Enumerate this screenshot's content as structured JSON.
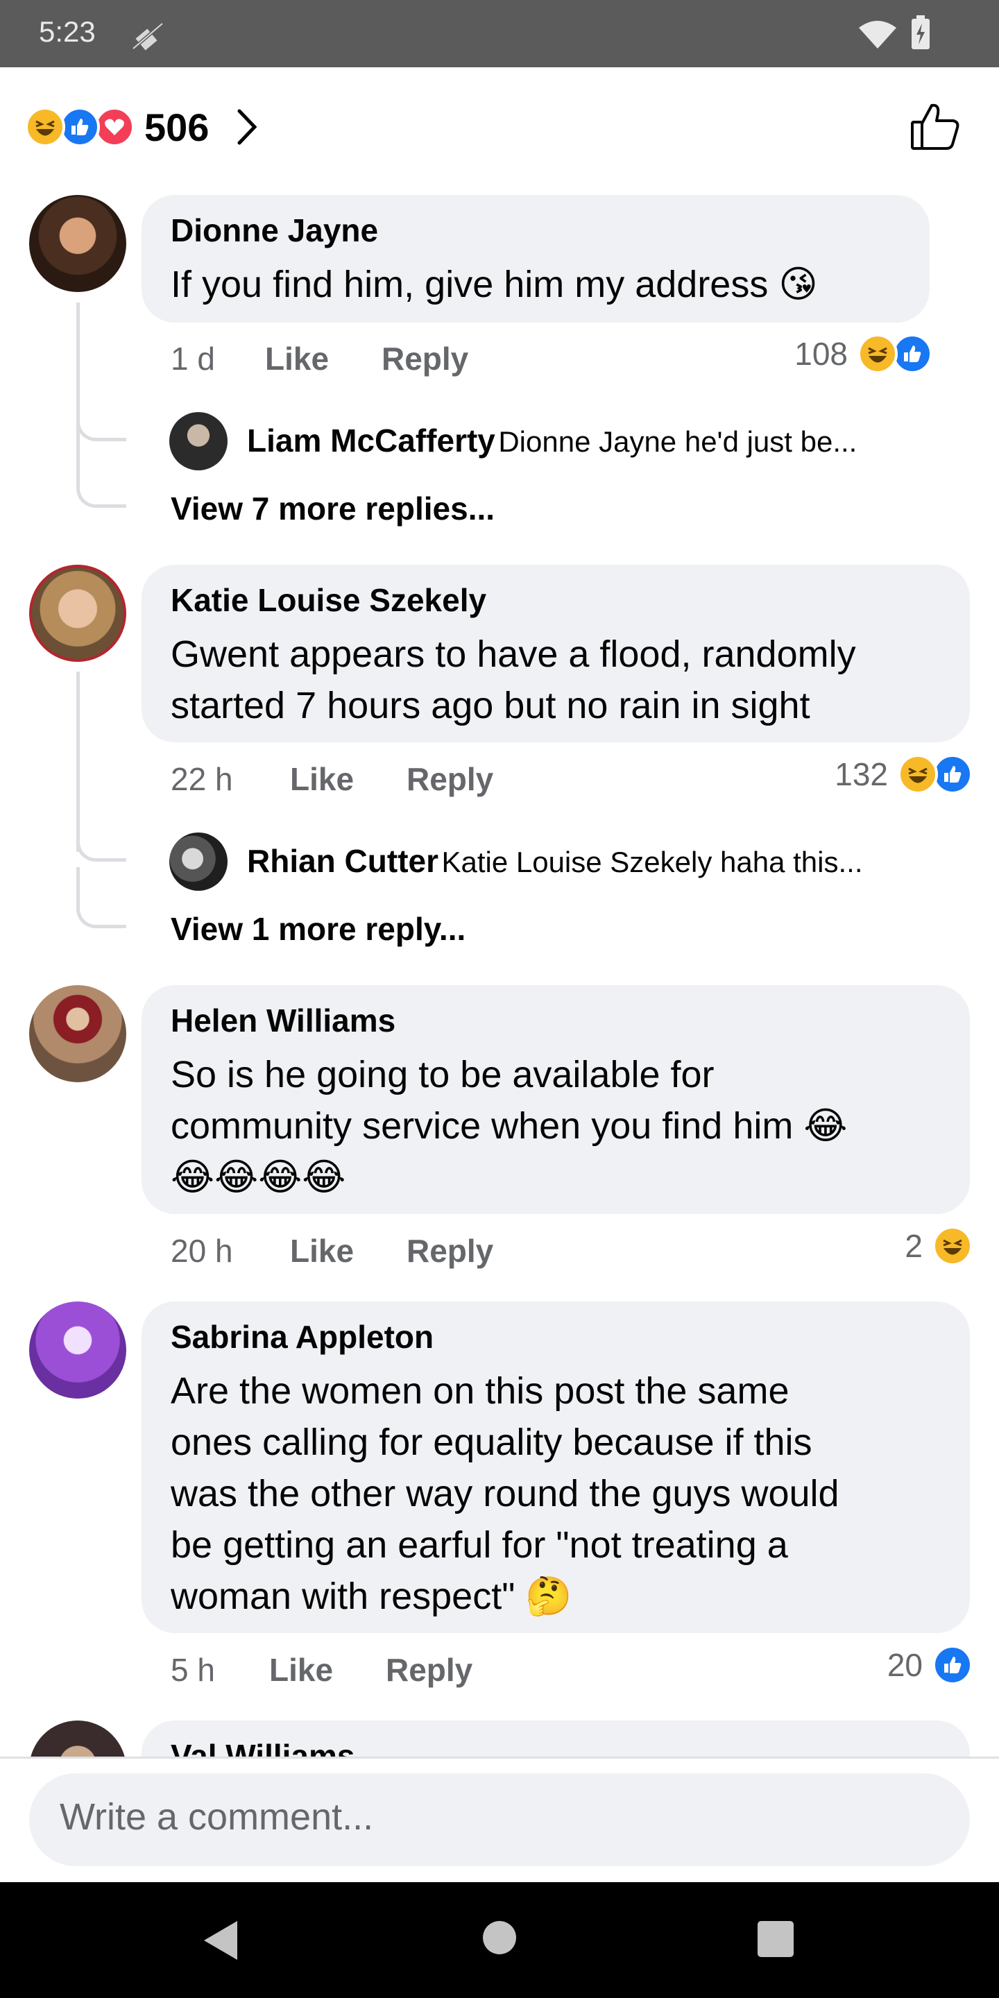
{
  "status_bar": {
    "time": "5:23"
  },
  "header": {
    "reaction_count": "506"
  },
  "comments": [
    {
      "author": "Dionne Jayne",
      "text_lines": [
        "If you find him, give him my address 😘"
      ],
      "time": "1 d",
      "like_label": "Like",
      "reply_label": "Reply",
      "reaction_count": "108",
      "reactions": [
        "haha-icon",
        "like-icon"
      ],
      "reply_preview": {
        "author": "Liam McCafferty",
        "snippet": "Dionne Jayne he'd just be..."
      },
      "view_more": "View 7 more replies..."
    },
    {
      "author": "Katie Louise Szekely",
      "text_lines": [
        "Gwent appears to have a flood, randomly",
        "started 7 hours ago but no rain in sight"
      ],
      "time": "22 h",
      "like_label": "Like",
      "reply_label": "Reply",
      "reaction_count": "132",
      "reactions": [
        "haha-icon",
        "like-icon"
      ],
      "reply_preview": {
        "author": "Rhian Cutter",
        "snippet": "Katie Louise Szekely  haha this..."
      },
      "view_more": "View 1 more reply..."
    },
    {
      "author": "Helen Williams",
      "text_lines": [
        "So is he going to be available for",
        "community service when you find him 😂",
        "😂😂😂😂"
      ],
      "time": "20 h",
      "like_label": "Like",
      "reply_label": "Reply",
      "reaction_count": "2",
      "reactions": [
        "haha-icon"
      ]
    },
    {
      "author": "Sabrina Appleton",
      "text_lines": [
        "Are the women on this post the same",
        "ones calling for equality because if this",
        "was the other way round the guys would",
        "be getting an earful for \"not treating a",
        "woman with respect\" 🤔"
      ],
      "time": "5 h",
      "like_label": "Like",
      "reply_label": "Reply",
      "reaction_count": "20",
      "reactions": [
        "like-icon"
      ]
    },
    {
      "author": "Val Williams"
    }
  ],
  "composer": {
    "placeholder": "Write a comment..."
  },
  "colors": {
    "like_blue": "#1877f2",
    "haha_yellow": "#f7b928",
    "love_red": "#f33e58",
    "bubble": "#f0f1f4",
    "meta_gray": "#65676b"
  }
}
